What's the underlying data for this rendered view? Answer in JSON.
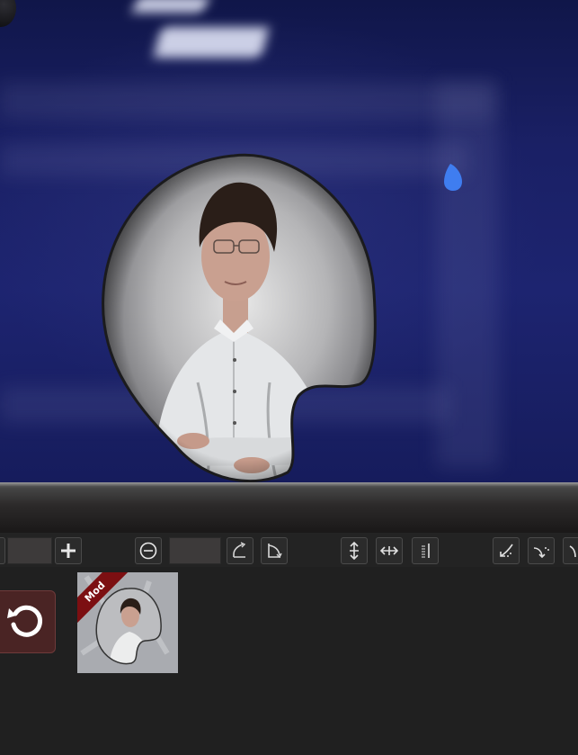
{
  "thumbnail": {
    "badge": "Mod"
  },
  "toolbar": {
    "buttons": [
      {
        "icon": "add-icon"
      },
      {
        "icon": "ellipse-shape-icon"
      },
      {
        "icon": "curve-corner-left-icon"
      },
      {
        "icon": "curve-corner-right-icon"
      },
      {
        "icon": "move-vertical-icon"
      },
      {
        "icon": "move-horizontal-icon"
      },
      {
        "icon": "vertical-text-icon"
      },
      {
        "icon": "arrow-curve-down-left-icon"
      },
      {
        "icon": "arrow-curve-down-dotted-icon"
      }
    ]
  },
  "colors": {
    "background_wall": "#1d2470",
    "toolbar_bg": "#232323",
    "undo_button_bg": "#4a2424",
    "badge_red": "#7c0f12",
    "marker_blue": "#3f7df0"
  }
}
